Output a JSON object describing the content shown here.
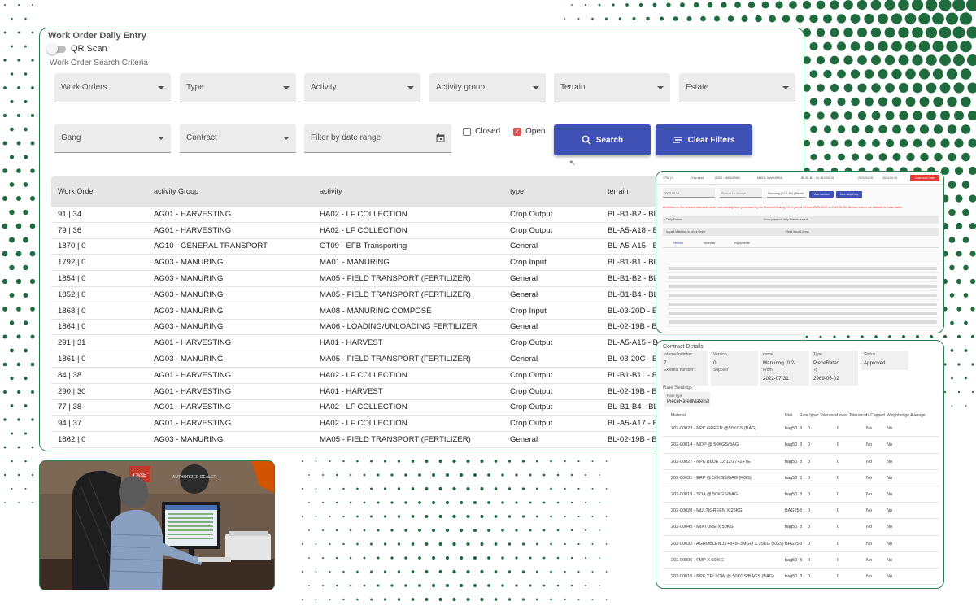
{
  "main": {
    "title": "Work Order Daily Entry",
    "qr_label": "QR Scan",
    "criteria_label": "Work Order Search Criteria",
    "filters_row1": [
      "Work Orders",
      "Type",
      "Activity",
      "Activity group",
      "Terrain",
      "Estate"
    ],
    "filters_row2": [
      "Gang",
      "Contract"
    ],
    "date_placeholder": "Filter by date range",
    "closed_label": "Closed",
    "open_label": "Open",
    "closed_checked": false,
    "open_checked": true,
    "search_label": "Search",
    "clear_label": "Clear Filters",
    "columns": [
      "Work Order",
      "activity Group",
      "activity",
      "type",
      "terrain"
    ],
    "rows": [
      [
        "91 | 34",
        "AG01 - HARVESTING",
        "HA02 - LF COLLECTION",
        "Crop Output",
        "BL-B1-B2 - BL"
      ],
      [
        "79 | 36",
        "AG01 - HARVESTING",
        "HA02 - LF COLLECTION",
        "Crop Output",
        "BL-A5-A18 - B"
      ],
      [
        "1870 | 0",
        "AG10 - GENERAL TRANSPORT",
        "GT09 - EFB Transporting",
        "General",
        "BL-A5-A15 - B"
      ],
      [
        "1792 | 0",
        "AG03 - MANURING",
        "MA01 - MANURING",
        "Crop Input",
        "BL-B1-B1 - BL"
      ],
      [
        "1854 | 0",
        "AG03 - MANURING",
        "MA05 - FIELD TRANSPORT (FERTILIZER)",
        "General",
        "BL-B1-B2 - BL"
      ],
      [
        "1852 | 0",
        "AG03 - MANURING",
        "MA05 - FIELD TRANSPORT (FERTILIZER)",
        "General",
        "BL-B1-B4 - BL"
      ],
      [
        "1868 | 0",
        "AG03 - MANURING",
        "MA08 - MANURING COMPOSE",
        "Crop Input",
        "BL-03-20D - B"
      ],
      [
        "1864 | 0",
        "AG03 - MANURING",
        "MA06 - LOADING/UNLOADING FERTILIZER",
        "General",
        "BL-02-19B - B"
      ],
      [
        "291 | 31",
        "AG01 - HARVESTING",
        "HA01 - HARVEST",
        "Crop Output",
        "BL-A5-A15 - B"
      ],
      [
        "1861 | 0",
        "AG03 - MANURING",
        "MA05 - FIELD TRANSPORT (FERTILIZER)",
        "General",
        "BL-03-20C - B"
      ],
      [
        "84 | 38",
        "AG01 - HARVESTING",
        "HA02 - LF COLLECTION",
        "Crop Output",
        "BL-B1-B11 - B"
      ],
      [
        "290 | 30",
        "AG01 - HARVESTING",
        "HA01 - HARVEST",
        "Crop Output",
        "BL-02-19B - B"
      ],
      [
        "77 | 38",
        "AG01 - HARVESTING",
        "HA02 - LF COLLECTION",
        "Crop Output",
        "BL-B1-B4 - BL"
      ],
      [
        "94 | 37",
        "AG01 - HARVESTING",
        "HA02 - LF COLLECTION",
        "Crop Output",
        "BL-A5-A17 - B"
      ],
      [
        "1862 | 0",
        "AG03 - MANURING",
        "MA05 - FIELD TRANSPORT (FERTILIZER)",
        "General",
        "BL-02-19B - B"
      ]
    ]
  },
  "thumb": {
    "header": [
      "1792 | 0",
      "Crop Input",
      "AG03 - MANURING",
      "MA01 - MANURING",
      "BL-B1-B1 - BL-BLOCK-01",
      "2024-04-15",
      "2024-04-15"
    ],
    "close_label": "Close work Order",
    "work_date": "2024-04-15",
    "reason_label": "Reason for change",
    "contract_label": "Manuring (0.2-1.99) | Pieceb",
    "view_contract": "View contract",
    "save_daily": "Save daily Entry",
    "warning": "All entries for the selected date/work order have already been processed by the Checkroll Bulung CO. 1 period 30 from 2024-04-01 to 2024-04-30. No new entries are allowed on these dates.",
    "daily_entries": "Daily Entries",
    "show_prev": "Show previous daily Entries records",
    "issued": "Issued Materials to Work Order",
    "show_issued": "Show issued items",
    "tabs": [
      "Partners",
      "Materials",
      "Equipments"
    ]
  },
  "contract": {
    "title": "Contract Details",
    "fields": [
      {
        "label": "Internal number",
        "value": "7"
      },
      {
        "label": "Version",
        "value": "0"
      },
      {
        "label": "name",
        "value": "Manuring (0.2-1.99)"
      },
      {
        "label": "Type",
        "value": "PieceRated"
      },
      {
        "label": "Status",
        "value": "Approved"
      },
      {
        "label": "External number",
        "value": ""
      },
      {
        "label": "Supplier",
        "value": ""
      },
      {
        "label": "From",
        "value": "2022-07-31"
      },
      {
        "label": "To",
        "value": "2969-05-02"
      }
    ],
    "rate_settings": "Rate Settings",
    "rate_type_label": "Rate type",
    "rate_type": "PieceRatedMaterial",
    "headers": [
      "Material",
      "Unit",
      "Rate",
      "Upper Tolerance",
      "Lower Tolerance",
      "Is Capped",
      "Weighbridge Average"
    ],
    "materials": [
      [
        "202-00023 - NPK GREEN @50KGS (BAG)",
        "bag50",
        "3",
        "0",
        "0",
        "No",
        "No"
      ],
      [
        "202-00014 - MOP @ 50KGS/BAG",
        "bag50",
        "3",
        "0",
        "0",
        "No",
        "No"
      ],
      [
        "202-00027 - NPK BLUE 12/12/17+2+TE",
        "bag50",
        "3",
        "0",
        "0",
        "No",
        "No"
      ],
      [
        "202-00031 - ERP @ 50KGS/BAG (KGS)",
        "bag50",
        "3",
        "0",
        "0",
        "No",
        "No"
      ],
      [
        "202-00019 - SOA @ 50KGS/BAG",
        "bag50",
        "3",
        "0",
        "0",
        "No",
        "No"
      ],
      [
        "202-00020 - MULTIGREEN X 25KG",
        "BAG25",
        "3",
        "0",
        "0",
        "No",
        "No"
      ],
      [
        "202-00045 - MIXTURE X 50KG",
        "bag50",
        "3",
        "0",
        "0",
        "No",
        "No"
      ],
      [
        "202-00032 - AGROBLEN 17+8+9+3MGO X 25KG (KGS)",
        "BAG25",
        "3",
        "0",
        "0",
        "No",
        "No"
      ],
      [
        "202-00006 - FMP X 50 KG",
        "bag50",
        "3",
        "0",
        "0",
        "No",
        "No"
      ],
      [
        "202-00015 - NPK YELLOW @ 50KGS/BAGS (BAG)",
        "bag50",
        "3",
        "0",
        "0",
        "No",
        "No"
      ]
    ]
  },
  "photo": {
    "sign_text": "AUTHORIZED DEALER",
    "sign_small": "CASE"
  },
  "colors": {
    "accent": "#3f51b5",
    "frame": "#2e7d4f",
    "dots": "#1f6b3d",
    "danger": "#d9534f"
  }
}
